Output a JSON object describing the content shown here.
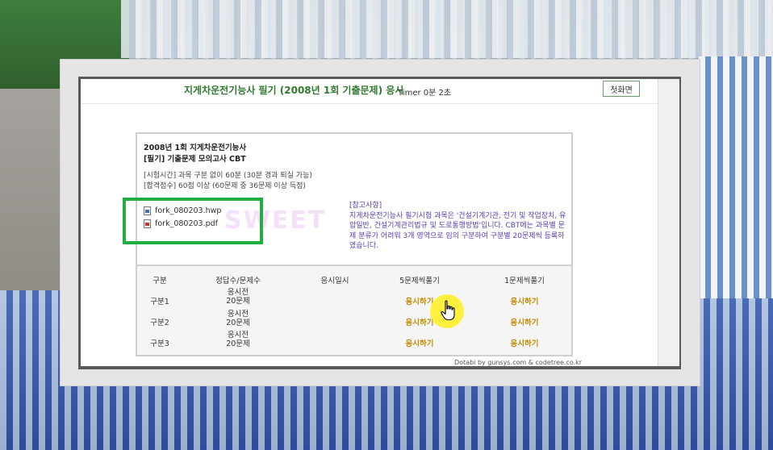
{
  "header": {
    "title": "지게차운전기능사 필기 (2008년 1회 기출문제) 응시",
    "timer": "Timer 0분 2초",
    "home_button": "첫화면"
  },
  "exam": {
    "title_line1": "2008년 1회 지게차운전기능사",
    "title_line2": "[필기] 기출문제 모의고사 CBT",
    "time_info": "[시험시간] 과목 구분 없이 60분 (30분 경과 퇴실 가능)",
    "pass_info": "[합격점수] 60점 이상 (60문제 중 36문제 이상 득점)"
  },
  "files": [
    {
      "name": "fork_080203.hwp",
      "icon": "hwp-file-icon"
    },
    {
      "name": "fork_080203.pdf",
      "icon": "pdf-file-icon"
    }
  ],
  "note": {
    "heading": "[참고사항]",
    "body": "지게차운전기능사 필기시험 과목은 '건설기계기관, 전기 및 작업장치, 유압일반, 건설기계관리법규 및 도로통행방법'입니다. CBT에는 과목별 문제 분류가 어려워 3개 영역으로 임의 구분하여 구분별 20문제씩 등록하였습니다."
  },
  "watermark": "SWEET",
  "table": {
    "headers": [
      "구분",
      "정답수/문제수",
      "응시일시",
      "5문제씩풀기",
      "1문제씩풀기"
    ],
    "rows": [
      {
        "section": "구분1",
        "status": "응시전",
        "count": "20문제",
        "date": "",
        "five": "응시하기",
        "one": "응시하기"
      },
      {
        "section": "구분2",
        "status": "응시전",
        "count": "20문제",
        "date": "",
        "five": "응시하기",
        "one": "응시하기"
      },
      {
        "section": "구분3",
        "status": "응시전",
        "count": "20문제",
        "date": "",
        "five": "응시하기",
        "one": "응시하기"
      }
    ]
  },
  "footer": {
    "credit": "Dotabi by gunsys.com & codetree.co.kr"
  },
  "colors": {
    "title_green": "#2f7a2f",
    "note_purple": "#5a3cb5",
    "link_gold": "#c48a00",
    "highlight_green": "#1fae3f",
    "cursor_yellow": "#fff028"
  }
}
